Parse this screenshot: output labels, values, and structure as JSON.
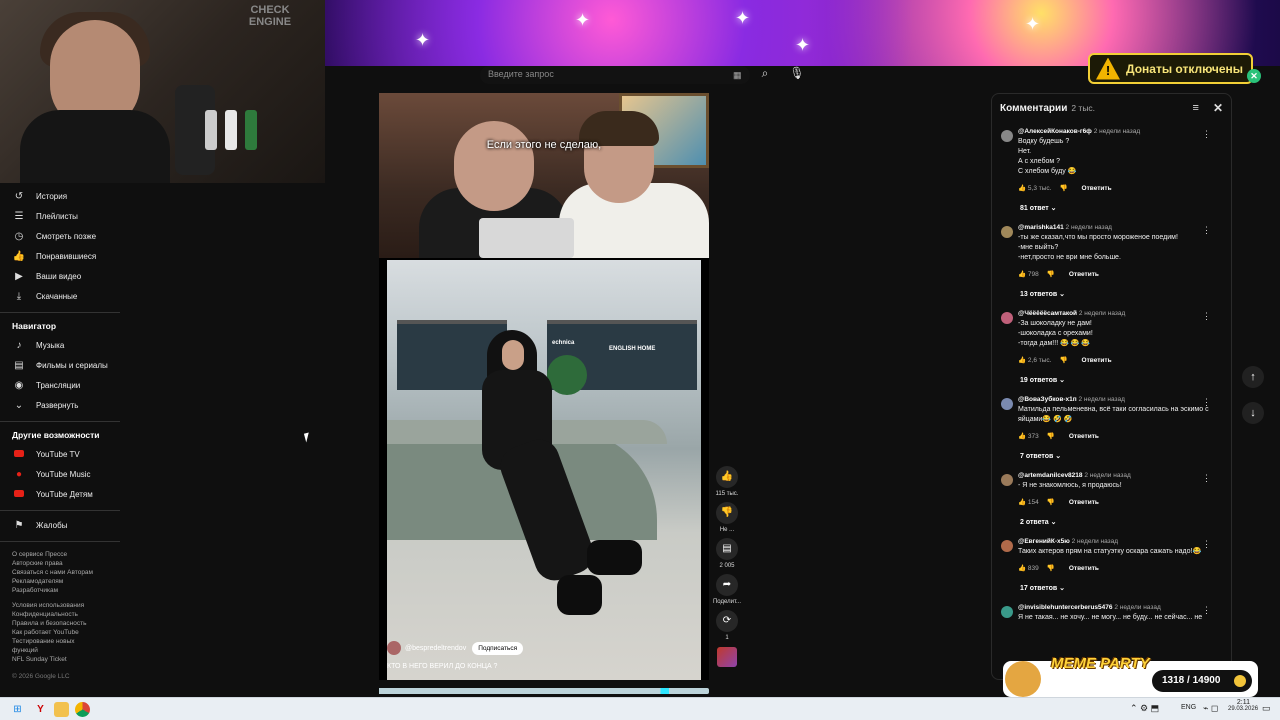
{
  "search": {
    "placeholder": "Введите запрос"
  },
  "sidebar": {
    "top_items": [
      {
        "label": "История",
        "icon": "history-icon"
      },
      {
        "label": "Плейлисты",
        "icon": "playlist-icon"
      },
      {
        "label": "Смотреть позже",
        "icon": "clock-icon"
      },
      {
        "label": "Понравившиеся",
        "icon": "thumb-up-icon"
      },
      {
        "label": "Ваши видео",
        "icon": "video-icon"
      },
      {
        "label": "Скачанные",
        "icon": "download-icon"
      }
    ],
    "navigator_heading": "Навигатор",
    "navigator_items": [
      {
        "label": "Музыка",
        "icon": "music-icon"
      },
      {
        "label": "Фильмы и сериалы",
        "icon": "film-icon"
      },
      {
        "label": "Трансляции",
        "icon": "live-icon"
      },
      {
        "label": "Развернуть",
        "icon": "chevron-down-icon"
      }
    ],
    "other_heading": "Другие возможности",
    "other_items": [
      {
        "label": "YouTube TV"
      },
      {
        "label": "YouTube Music"
      },
      {
        "label": "YouTube Детям"
      }
    ],
    "report": "Жалобы",
    "footer_line1": "О сервисе  Прессе",
    "footer_line2": "Авторские права",
    "footer_line3": "Связаться с нами  Авторам",
    "footer_line4": "Рекламодателям",
    "footer_line5": "Разработчикам",
    "footer_line6": "Условия использования",
    "footer_line7": "Конфиденциальность",
    "footer_line8": "Правила и безопасность",
    "footer_line9": "Как работает YouTube",
    "footer_line10": "Тестирование новых",
    "footer_line11": "функций",
    "footer_line12": "NFL Sunday Ticket",
    "copyright": "© 2026 Google LLC"
  },
  "video": {
    "subtitle": "Если этого не сделаю,",
    "channel": "@bespredeltrendov",
    "subscribe": "Подписаться",
    "caption": "КТО В НЕГО ВЕРИЛ ДО КОНЦА ?",
    "progress": 0.88,
    "store_signs": [
      "ENGLISH HOME",
      "echnica"
    ]
  },
  "actions": {
    "likes": "115 тыс.",
    "dislike": "Не ...",
    "comments": "2 005",
    "share": "Поделит...",
    "remix": "1"
  },
  "donate": {
    "label": "Донаты отключены"
  },
  "webcam": {
    "sign": "CHECK ENGINE"
  },
  "comments": {
    "title": "Комментарии",
    "count": "2 тыс.",
    "reply_label": "Ответить",
    "items": [
      {
        "author": "@АлексейКонаков-г6ф",
        "time": "2 недели назад",
        "text": "Водку будешь ?\nНет.\nА с хлебом ?\nС хлебом буду 😂",
        "likes": "5,3 тыс.",
        "replies": "81 ответ",
        "avatar": "#888888"
      },
      {
        "author": "@marishka141",
        "time": "2 недели назад",
        "text": "-ты же сказал,что мы просто мороженое поедим!\n-мне выйть?\n-нет,просто не ври мне больше.",
        "likes": "798",
        "replies": "13 ответов",
        "avatar": "#a0885a"
      },
      {
        "author": "@Чёёёёёсамтакой",
        "time": "2 недели назад",
        "text": "-За шоколадку не дам!\n-шоколадка с орехами!\n-тогда дам!!! 😂 😂 😂",
        "likes": "2,6 тыс.",
        "replies": "19 ответов",
        "avatar": "#c0607a"
      },
      {
        "author": "@ВоваЗубков-х1п",
        "time": "2 недели назад",
        "text": "Матильда пельменевна, всё таки согласилась на эскимо с яйцами😂 🤣 🤣",
        "likes": "373",
        "replies": "7 ответов",
        "avatar": "#7a8ab0"
      },
      {
        "author": "@artemdanilcev8218",
        "time": "2 недели назад",
        "text": "- Я не знакомлюсь, я продаюсь!",
        "likes": "154",
        "replies": "2 ответа",
        "avatar": "#9a7a5a"
      },
      {
        "author": "@ЕвгенийК-х5ю",
        "time": "2 недели назад",
        "text": "Таких актеров прям на статуэтку  оскара сажать надо!😂",
        "likes": "839",
        "replies": "17 ответов",
        "avatar": "#b06a4a"
      },
      {
        "author": "@invisiblehuntercerberus5476",
        "time": "2 недели назад",
        "text": "Я не такая... не хочу... не могу... не буду... не сейчас... не",
        "likes": "",
        "replies": "",
        "avatar": "#3a9a8a"
      }
    ]
  },
  "meme": {
    "title": "MEME PARTY",
    "progress": "1318 / 14900"
  },
  "taskbar": {
    "lang": "ENG",
    "time": "2:11",
    "date": "29.03.2026"
  }
}
